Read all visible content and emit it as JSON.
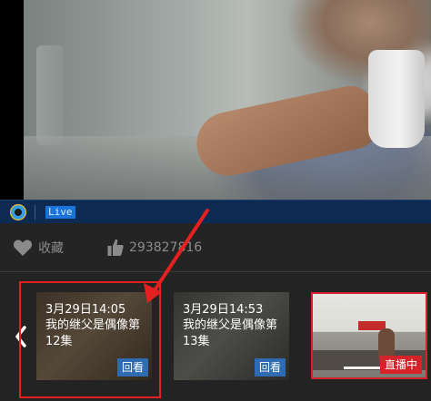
{
  "player": {
    "live_label": "Live",
    "logo_icon": "player-logo-icon"
  },
  "actions": {
    "favorite_label": "收藏",
    "favorite_icon": "heart-icon",
    "like_count": "293827816",
    "like_icon": "thumbs-up-icon"
  },
  "episodes": [
    {
      "time": "3月29日14:05",
      "title": "我的继父是偶像第12集",
      "action": "回看"
    },
    {
      "time": "3月29日14:53",
      "title": "我的继父是偶像第13集",
      "action": "回看"
    },
    {
      "time": "",
      "title": "",
      "action": "直播中"
    }
  ],
  "colors": {
    "accent_blue": "#2f6bb0",
    "live_red": "#d8222a",
    "annotation_red": "#e62020"
  }
}
